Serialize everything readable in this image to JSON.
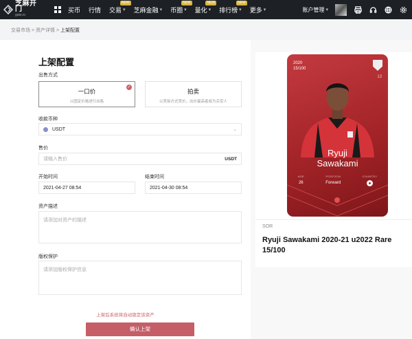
{
  "header": {
    "logo_main": "芝麻开门",
    "logo_sub": "gate.io",
    "nav": [
      {
        "label": "买币",
        "badge": "",
        "dropdown": false
      },
      {
        "label": "行情",
        "badge": "",
        "dropdown": false
      },
      {
        "label": "交易",
        "badge": "NEW",
        "dropdown": true
      },
      {
        "label": "芝麻金融",
        "badge": "",
        "dropdown": true
      },
      {
        "label": "币圈",
        "badge": "NEW",
        "dropdown": true
      },
      {
        "label": "量化",
        "badge": "NEW",
        "dropdown": true
      },
      {
        "label": "排行榜",
        "badge": "NEW",
        "dropdown": true
      },
      {
        "label": "更多",
        "badge": "",
        "dropdown": true
      }
    ],
    "account_label": "账户管理",
    "icons": [
      "printer-icon",
      "headset-icon",
      "globe-icon",
      "gear-icon"
    ]
  },
  "breadcrumb": {
    "items": [
      "交易市场",
      "资产详情"
    ],
    "separator": ">",
    "current": "上架配置"
  },
  "form": {
    "title": "上架配置",
    "sale_type": {
      "label": "出售方式",
      "options": [
        {
          "title": "一口价",
          "subtitle": "以固定价格进行出售",
          "selected": true
        },
        {
          "title": "拍卖",
          "subtitle": "以竞拍方式竞价，出价最高者成为买受人",
          "selected": false
        }
      ]
    },
    "currency": {
      "label": "收款币种",
      "value": "USDT"
    },
    "price": {
      "label": "售价",
      "placeholder": "请输入售价",
      "suffix": "USDT"
    },
    "start_time": {
      "label": "开始时间",
      "value": "2021-04-27 08:54"
    },
    "end_time": {
      "label": "结束时间",
      "value": "2021-04-30 08:54"
    },
    "description": {
      "label": "资产描述",
      "placeholder": "请添加对资产的描述"
    },
    "copyright": {
      "label": "版权保护",
      "placeholder": "请添加版权保护信息"
    },
    "note": "上架后系统将自动锁定该资产",
    "submit_label": "确认上架"
  },
  "preview": {
    "card": {
      "year": "2020",
      "serial": "15/100",
      "number": "13",
      "name_line1": "Ryuji",
      "name_line2": "Sawakami",
      "stats": [
        {
          "label": "AGE",
          "value": "26"
        },
        {
          "label": "POSITION",
          "value": "Forward"
        },
        {
          "label": "COUNTRY",
          "value": ""
        }
      ]
    },
    "source": "SOR",
    "title": "Ryuji Sawakami 2020-21 u2022 Rare 15/100"
  },
  "colors": {
    "topbar": "#1d2024",
    "accent": "#c55e66",
    "card_red": "#b12e33"
  }
}
